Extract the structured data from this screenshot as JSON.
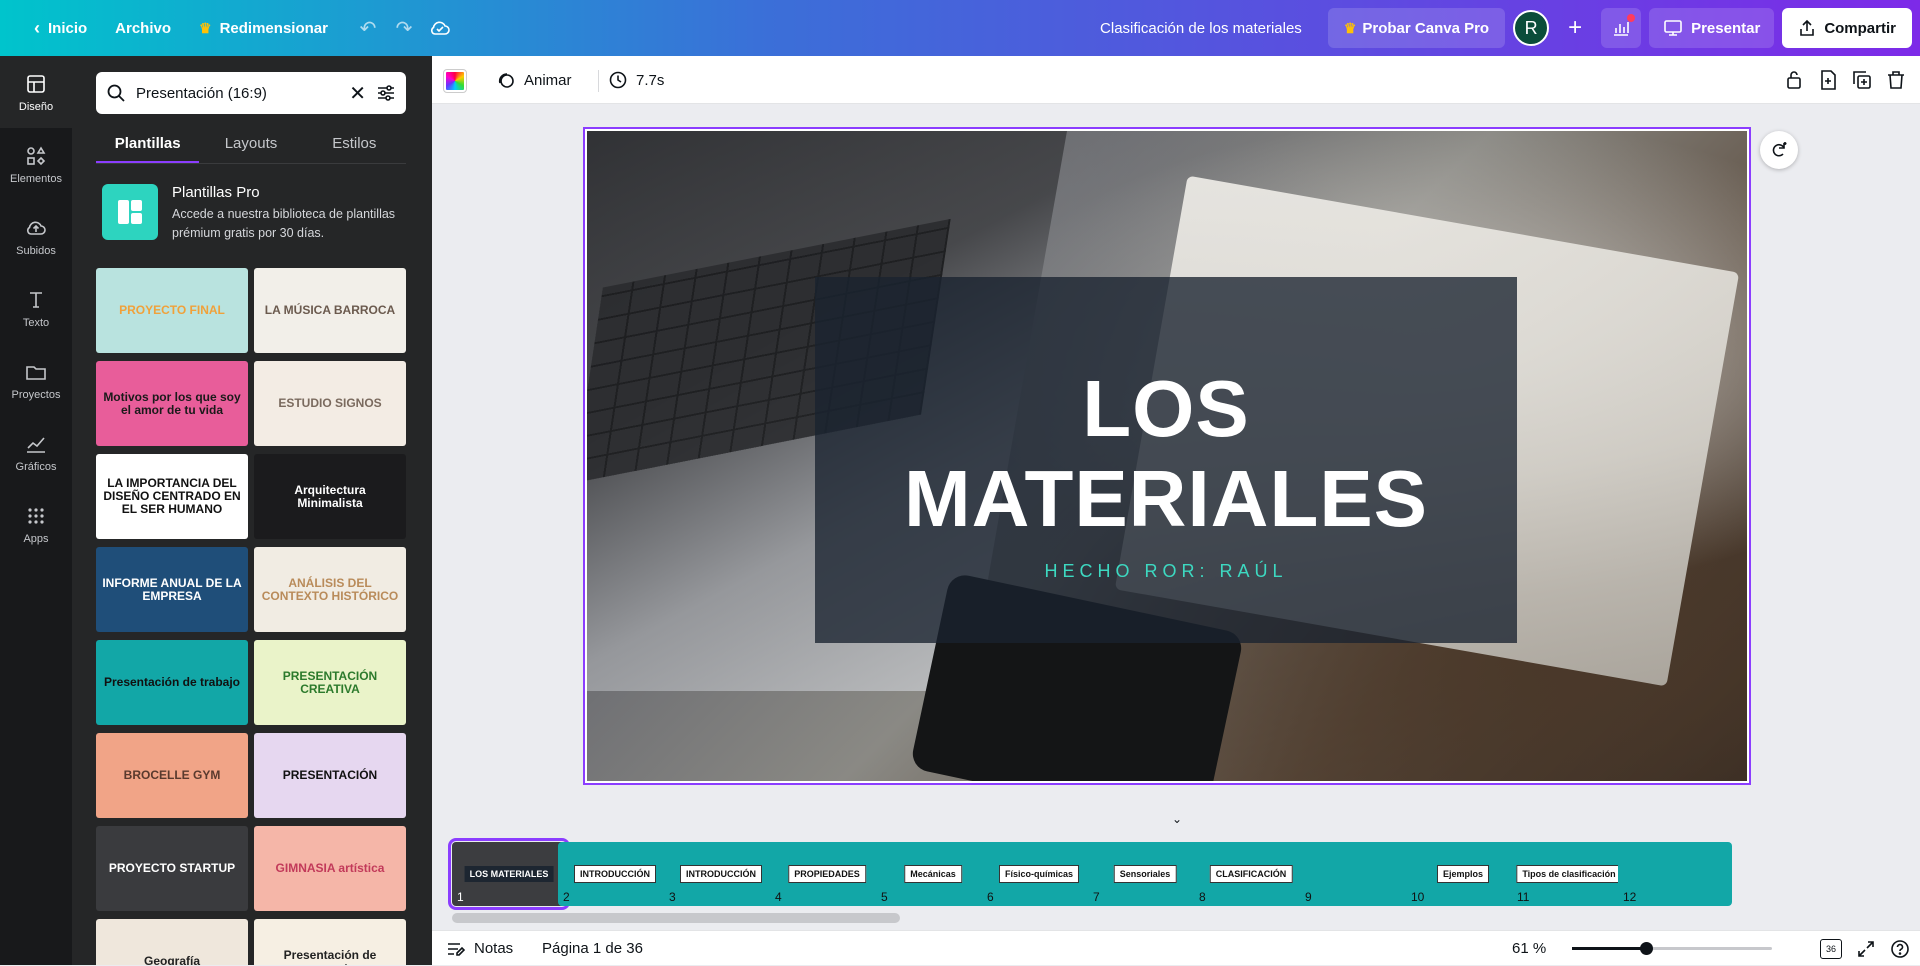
{
  "topbar": {
    "home_label": "Inicio",
    "file_label": "Archivo",
    "resize_label": "Redimensionar",
    "doc_title": "Clasificación de los materiales",
    "try_pro_label": "Probar Canva Pro",
    "avatar_letter": "R",
    "present_label": "Presentar",
    "share_label": "Compartir"
  },
  "rail": {
    "items": [
      {
        "label": "Diseño",
        "icon": "layout-icon"
      },
      {
        "label": "Elementos",
        "icon": "shapes-icon"
      },
      {
        "label": "Subidos",
        "icon": "upload-cloud-icon"
      },
      {
        "label": "Texto",
        "icon": "text-icon"
      },
      {
        "label": "Proyectos",
        "icon": "folder-icon"
      },
      {
        "label": "Gráficos",
        "icon": "chart-icon"
      },
      {
        "label": "Apps",
        "icon": "apps-grid-icon"
      }
    ]
  },
  "panel": {
    "search_value": "Presentación (16:9)",
    "tabs": [
      "Plantillas",
      "Layouts",
      "Estilos"
    ],
    "promo_title": "Plantillas Pro",
    "promo_desc": "Accede a nuestra biblioteca de plantillas prémium gratis por 30 días.",
    "templates": [
      {
        "text": "PROYECTO FINAL",
        "bg": "#b9e3df",
        "color": "#f0a13a"
      },
      {
        "text": "LA MÚSICA BARROCA",
        "bg": "#f2efe9",
        "color": "#6b5a4e"
      },
      {
        "text": "Motivos por los que soy el amor de tu vida",
        "bg": "#e85d9a",
        "color": "#1a1a1a"
      },
      {
        "text": "ESTUDIO SIGNOS",
        "bg": "#f3ece4",
        "color": "#7a6a5e"
      },
      {
        "text": "LA IMPORTANCIA DEL DISEÑO CENTRADO EN EL SER HUMANO",
        "bg": "#ffffff",
        "color": "#111111"
      },
      {
        "text": "Arquitectura Minimalista",
        "bg": "#1b1b1d",
        "color": "#ffffff"
      },
      {
        "text": "INFORME ANUAL DE LA EMPRESA",
        "bg": "#1f4e79",
        "color": "#ffffff"
      },
      {
        "text": "ANÁLISIS DEL CONTEXTO HISTÓRICO",
        "bg": "#f1ece3",
        "color": "#b98b5a"
      },
      {
        "text": "Presentación de trabajo",
        "bg": "#12a7a7",
        "color": "#111111"
      },
      {
        "text": "PRESENTACIÓN CREATIVA",
        "bg": "#eaf3c9",
        "color": "#2c7a2c"
      },
      {
        "text": "BROCELLE GYM",
        "bg": "#f1a487",
        "color": "#5a3a2e"
      },
      {
        "text": "PRESENTACIÓN",
        "bg": "#e6d7f0",
        "color": "#111111"
      },
      {
        "text": "PROYECTO STARTUP",
        "bg": "#3a3b3e",
        "color": "#ffffff"
      },
      {
        "text": "GIMNASIA artística",
        "bg": "#f5b6a8",
        "color": "#c23a5a"
      },
      {
        "text": "Geografía",
        "bg": "#efe7dc",
        "color": "#222222"
      },
      {
        "text": "Presentación de proyecto",
        "bg": "#f6efe3",
        "color": "#222222"
      }
    ]
  },
  "editor": {
    "animate_label": "Animar",
    "duration_label": "7.7s"
  },
  "slide": {
    "title_line1": "LOS",
    "title_line2": "MATERIALES",
    "subtitle": "HECHO ROR: RAÚL"
  },
  "filmstrip": [
    {
      "num": "1",
      "label": "LOS MATERIALES"
    },
    {
      "num": "2",
      "label": "INTRODUCCIÓN"
    },
    {
      "num": "3",
      "label": "INTRODUCCIÓN"
    },
    {
      "num": "4",
      "label": "PROPIEDADES"
    },
    {
      "num": "5",
      "label": "Mecánicas"
    },
    {
      "num": "6",
      "label": "Físico-químicas"
    },
    {
      "num": "7",
      "label": "Sensoriales"
    },
    {
      "num": "8",
      "label": "CLASIFICACIÓN"
    },
    {
      "num": "9",
      "label": ""
    },
    {
      "num": "10",
      "label": "Ejemplos"
    },
    {
      "num": "11",
      "label": "Tipos de clasificación"
    },
    {
      "num": "12",
      "label": ""
    }
  ],
  "bottombar": {
    "notes_label": "Notas",
    "page_label": "Página 1 de 36",
    "zoom_label": "61 %",
    "pages_count": "36"
  }
}
